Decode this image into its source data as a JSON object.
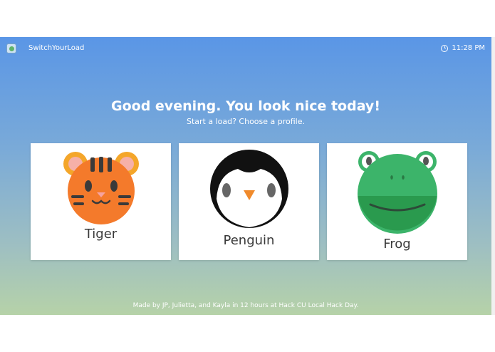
{
  "header": {
    "app_name": "SwitchYourLoad",
    "time": "11:28 PM"
  },
  "greeting": {
    "title": "Good evening. You look nice today!",
    "subtitle": "Start a load? Choose a profile."
  },
  "profiles": [
    {
      "label": "Tiger",
      "icon": "tiger-face-icon"
    },
    {
      "label": "Penguin",
      "icon": "penguin-face-icon"
    },
    {
      "label": "Frog",
      "icon": "frog-face-icon"
    }
  ],
  "footer": {
    "text": "Made by JP, Julietta, and Kayla in 12 hours at Hack CU Local Hack Day."
  },
  "colors": {
    "tiger": "#f47a2b",
    "frog": "#3cb46a",
    "penguin": "#111111",
    "bg_top": "#5a96e6",
    "bg_bottom": "#b6d2a8"
  }
}
